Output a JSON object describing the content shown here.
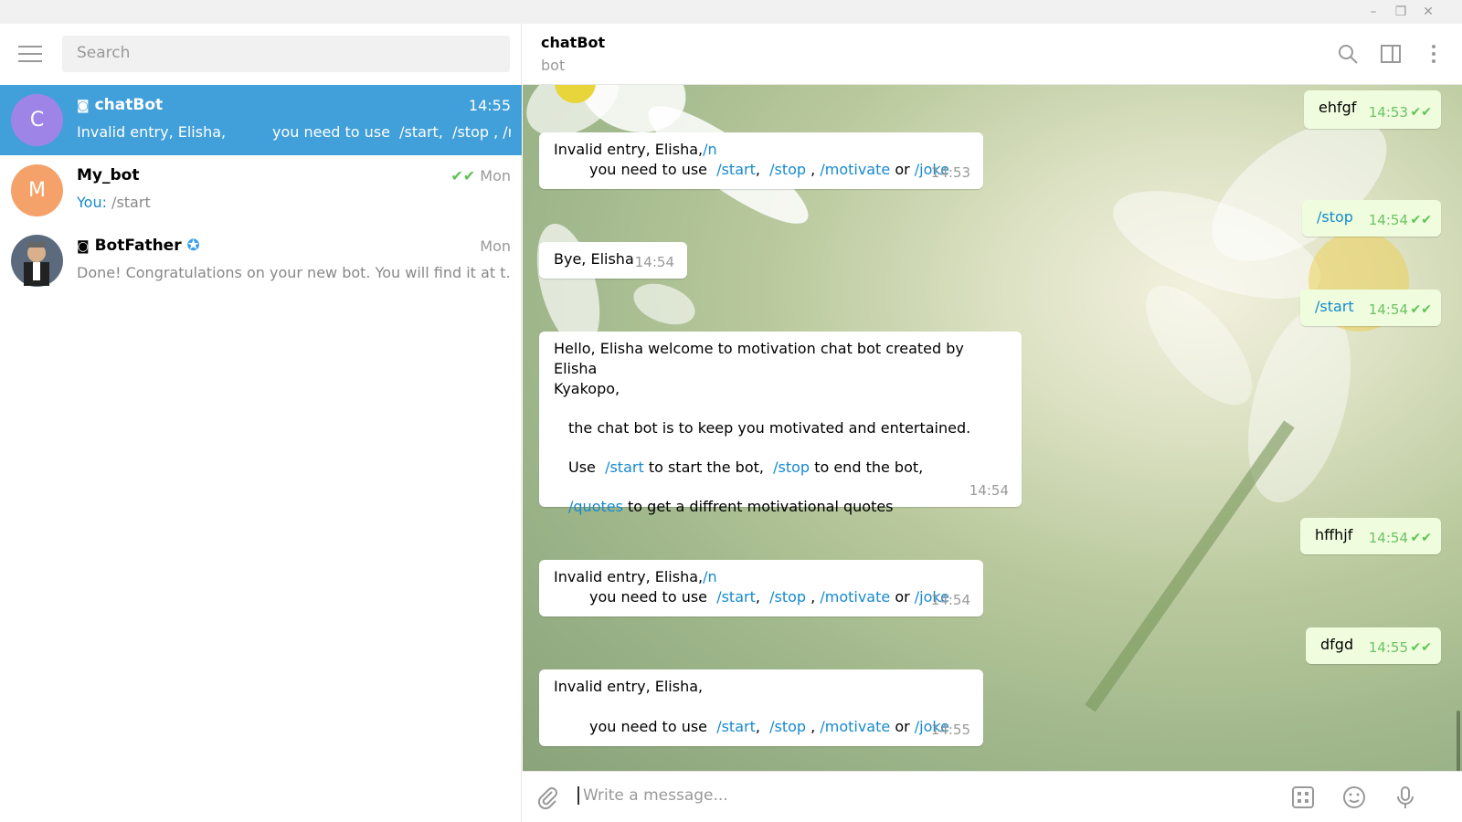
{
  "window": {
    "minimize_icon": "minimize-icon",
    "maximize_icon": "restore-icon",
    "close_icon": "close-icon"
  },
  "search": {
    "placeholder": "Search"
  },
  "dialogs": [
    {
      "name": "chatBot",
      "avatar_letter": "C",
      "avatar_color": "#9f84e8",
      "time": "14:55",
      "preview": "Invalid entry, Elisha,          you need to use  /start,  /stop , /mo...",
      "bot": true
    },
    {
      "name": "My_bot",
      "avatar_letter": "M",
      "avatar_color": "#f5a26a",
      "time": "Mon",
      "preview_prefix": "You:",
      "preview": " /start"
    },
    {
      "name": "BotFather",
      "time": "Mon",
      "preview": "Done! Congratulations on your new bot. You will find it at t.m...",
      "bot": true,
      "verified": true
    }
  ],
  "chat": {
    "title": "chatBot",
    "subtitle": "bot",
    "composer_placeholder": "Write a message..."
  },
  "messages": {
    "m1": {
      "text": "ehfgf",
      "time": "14:53"
    },
    "m2": {
      "line1": "Invalid entry, Elisha,",
      "line1_link": "/n",
      "line2": "you need to use",
      "start": "/start",
      "stop": "/stop",
      "motivate": "/motivate",
      "or": "or",
      "joke": "/joke",
      "time": "14:53"
    },
    "m3": {
      "text": "/stop",
      "time": "14:54"
    },
    "m4": {
      "text": "Bye, Elisha",
      "time": "14:54"
    },
    "m5": {
      "text": "/start",
      "time": "14:54"
    },
    "m6": {
      "l1": "Hello, Elisha welcome to motivation chat bot created by Elisha",
      "l2": "Kyakopo,",
      "l3": "the chat bot is to keep you motivated and entertained.",
      "use": "Use",
      "start": "/start",
      "to_start": "to start the bot,",
      "stop": "/stop",
      "to_end": "to end the bot,",
      "quotes": "/quotes",
      "to_get": "to get a diffrent motivational quotes",
      "time": "14:54"
    },
    "m7": {
      "text": "hffhjf",
      "time": "14:54"
    },
    "m8": {
      "line1": "Invalid entry, Elisha,",
      "line1_link": "/n",
      "line2": "you need to use",
      "start": "/start",
      "stop": "/stop",
      "motivate": "/motivate",
      "or": "or",
      "joke": "/joke",
      "time": "14:54"
    },
    "m9": {
      "text": "dfgd",
      "time": "14:55"
    },
    "m10": {
      "line1": "Invalid entry, Elisha,",
      "line2": "you need to use",
      "start": "/start",
      "stop": "/stop",
      "motivate": "/motivate",
      "or": "or",
      "joke": "/joke",
      "time": "14:55"
    }
  },
  "colors": {
    "accent": "#419fd9",
    "link": "#168acd",
    "out_bubble": "#effdde",
    "check": "#5dc452"
  }
}
